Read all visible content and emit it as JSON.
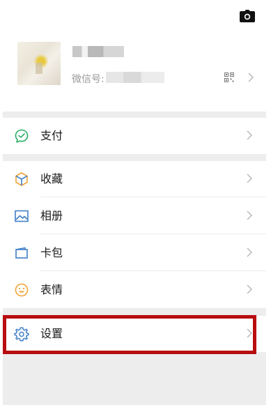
{
  "profile": {
    "nickname": "",
    "wechat_id_label": "微信号:",
    "wechat_id_value": ""
  },
  "menu": {
    "pay": "支付",
    "favorites": "收藏",
    "album": "相册",
    "cards": "卡包",
    "stickers": "表情",
    "settings": "设置"
  },
  "icons": {
    "camera": "camera-icon",
    "qr": "qr-code-icon",
    "chevron": "chevron-right-icon",
    "pay": "wallet-check-icon",
    "favorites": "cube-icon",
    "album": "picture-icon",
    "cards": "card-wallet-icon",
    "stickers": "smiley-icon",
    "settings": "gear-icon"
  },
  "colors": {
    "green": "#2aae67",
    "orange": "#f2a33a",
    "blue": "#3f7fc6",
    "highlight": "#b80d10",
    "separator": "#ededed"
  }
}
